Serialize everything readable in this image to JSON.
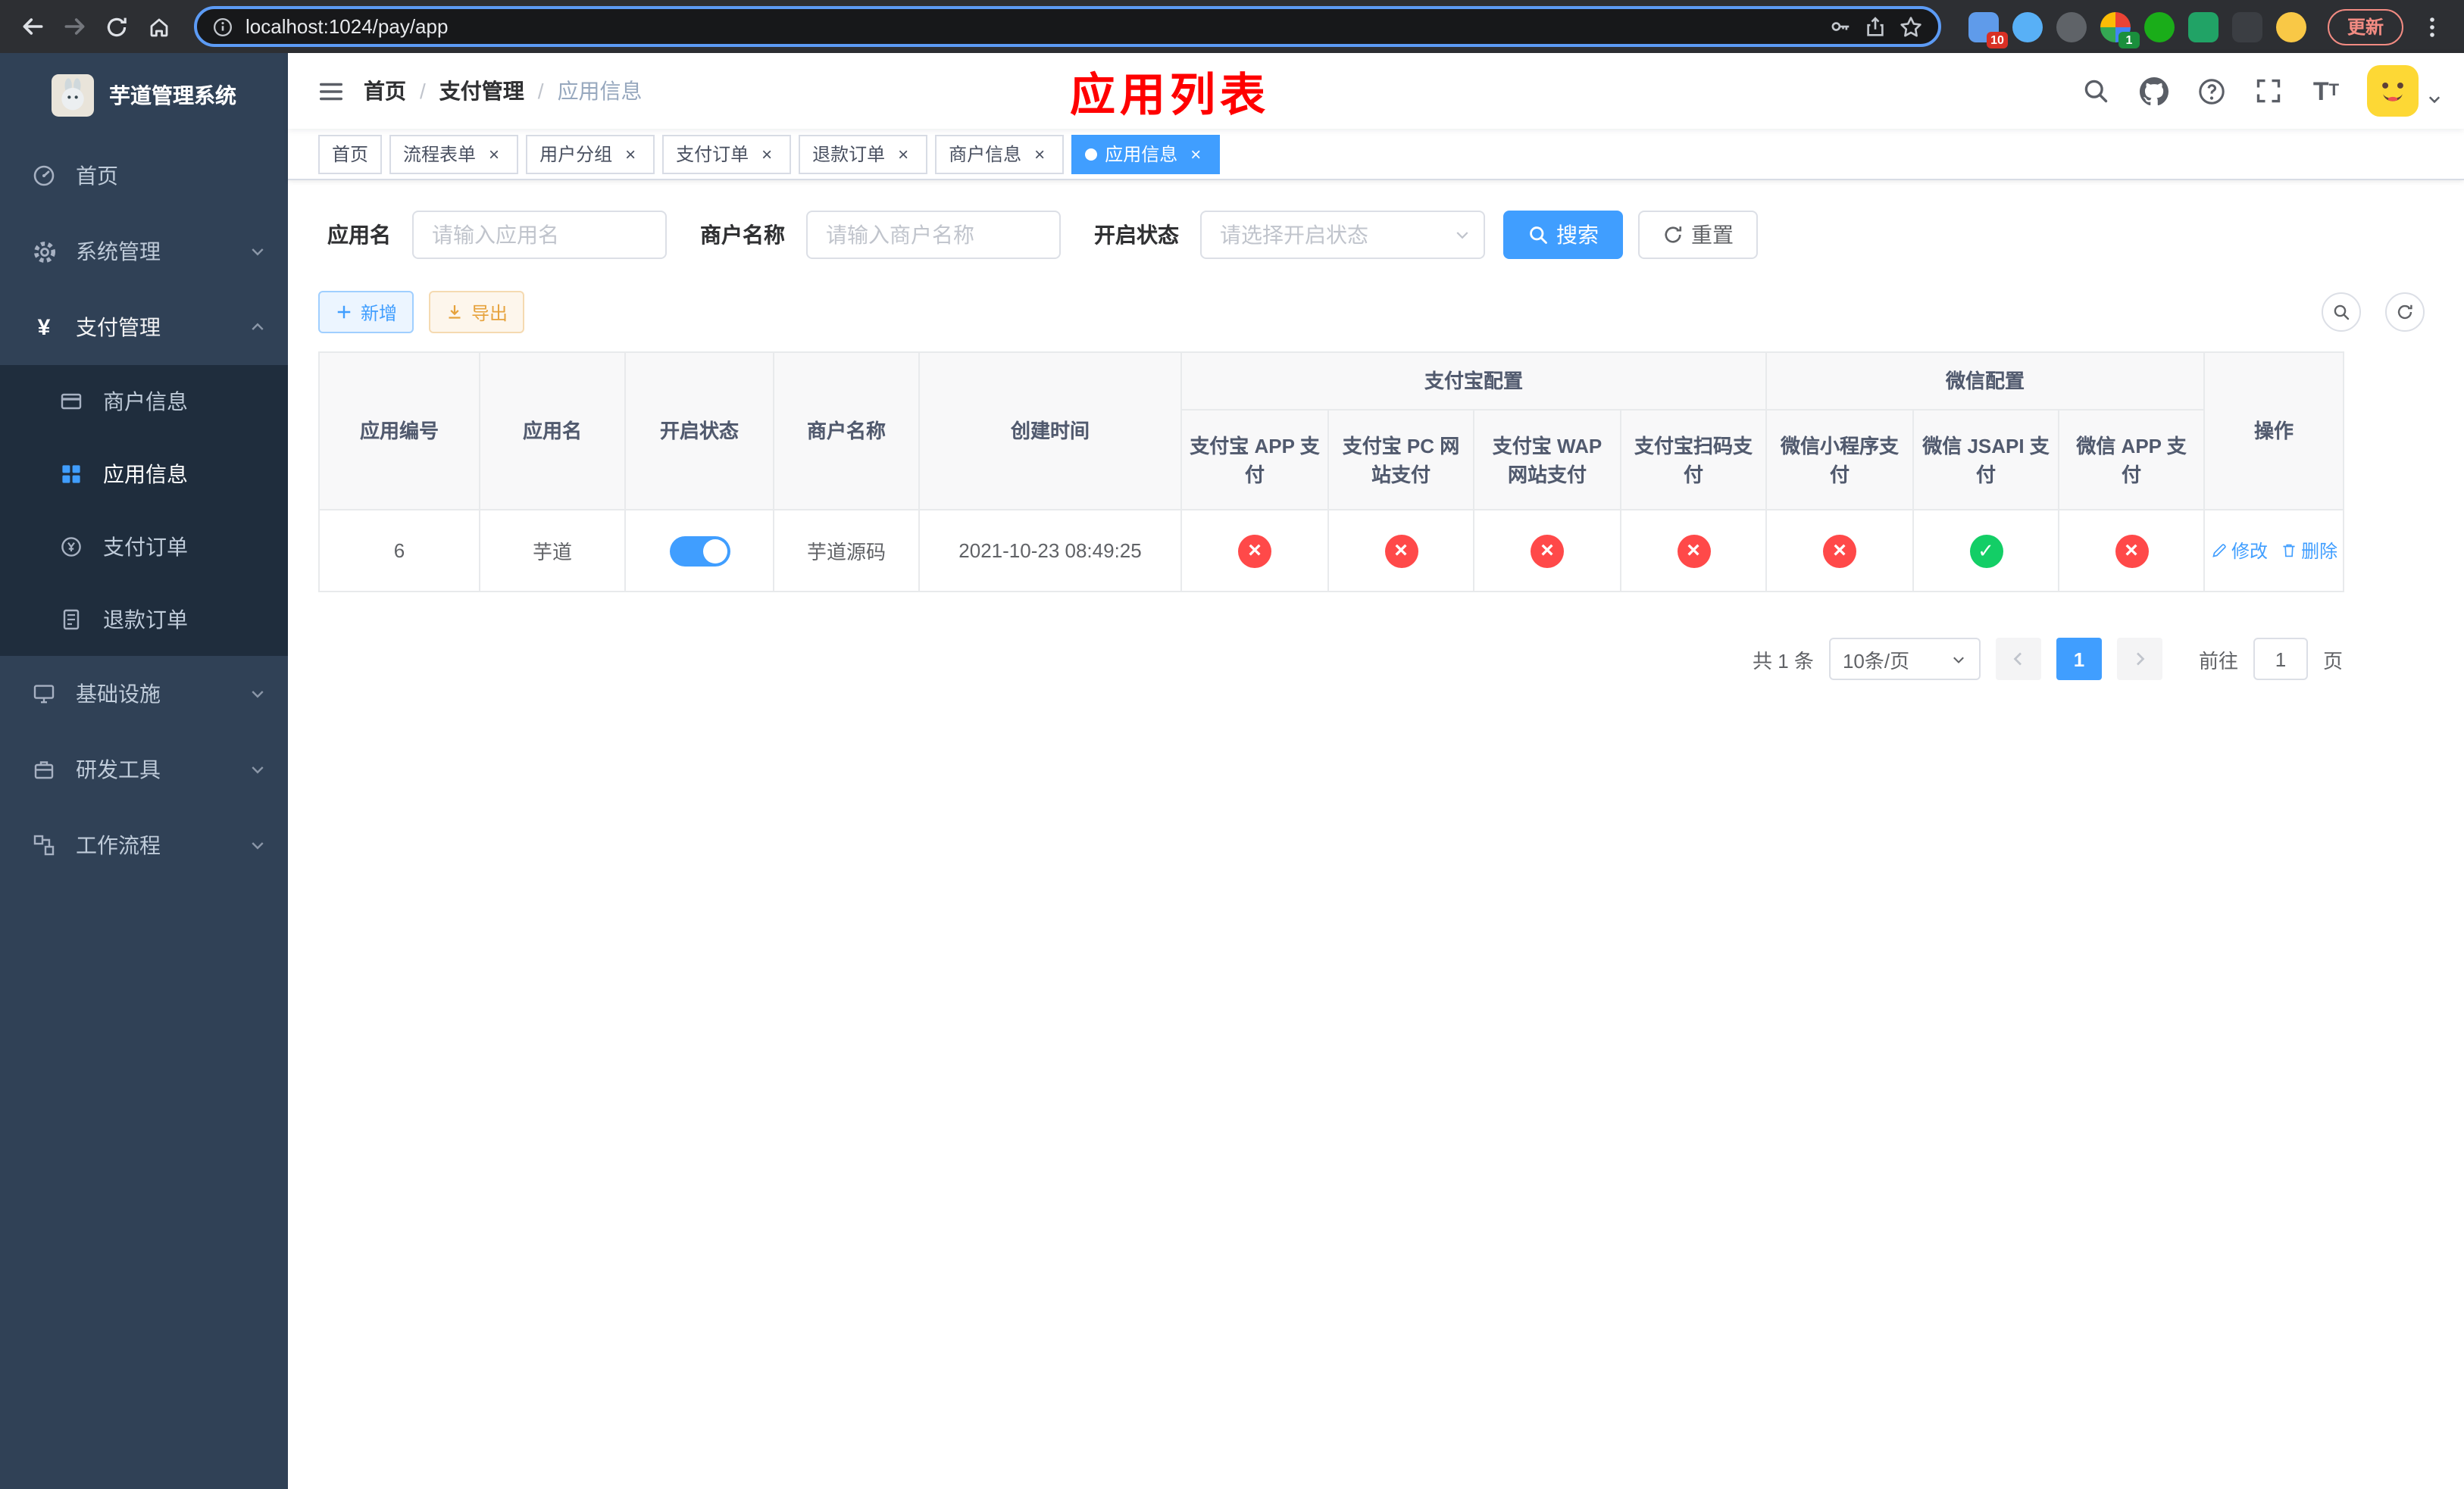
{
  "colors": {
    "accent": "#409eff",
    "ok": "#13ce66",
    "fail": "#ff4949",
    "title": "#ff0000",
    "warning": "#e6a23c"
  },
  "browser": {
    "url": "localhost:1024/pay/app",
    "update_label": "更新",
    "extensions_badge_1": "10",
    "extensions_badge_2": "1"
  },
  "sidebar": {
    "app_title": "芋道管理系统",
    "menu": [
      "首页",
      "系统管理",
      "支付管理",
      "基础设施",
      "研发工具",
      "工作流程"
    ],
    "submenu": [
      "商户信息",
      "应用信息",
      "支付订单",
      "退款订单"
    ]
  },
  "navbar": {
    "breadcrumb": [
      "首页",
      "支付管理",
      "应用信息"
    ],
    "page_title": "应用列表"
  },
  "tags": [
    "首页",
    "流程表单",
    "用户分组",
    "支付订单",
    "退款订单",
    "商户信息",
    "应用信息"
  ],
  "filters": {
    "app_name_label": "应用名",
    "app_name_placeholder": "请输入应用名",
    "merchant_label": "商户名称",
    "merchant_placeholder": "请输入商户名称",
    "status_label": "开启状态",
    "status_placeholder": "请选择开启状态",
    "search_label": "搜索",
    "reset_label": "重置"
  },
  "toolbar": {
    "add_label": "新增",
    "export_label": "导出"
  },
  "table": {
    "headers": {
      "id": "应用编号",
      "name": "应用名",
      "status": "开启状态",
      "merchant": "商户名称",
      "created": "创建时间",
      "alipay_group": "支付宝配置",
      "wechat_group": "微信配置",
      "alipay_app": "支付宝 APP 支付",
      "alipay_pc": "支付宝 PC 网站支付",
      "alipay_wap": "支付宝 WAP 网站支付",
      "alipay_scan": "支付宝扫码支付",
      "wx_mini": "微信小程序支付",
      "wx_jsapi": "微信 JSAPI 支付",
      "wx_app": "微信 APP 支付",
      "action": "操作"
    },
    "row": {
      "id": "6",
      "name": "芋道",
      "enabled": true,
      "merchant": "芋道源码",
      "created": "2021-10-23 08:49:25",
      "channels": [
        "fail",
        "fail",
        "fail",
        "fail",
        "fail",
        "ok",
        "fail"
      ],
      "edit_label": "修改",
      "delete_label": "删除"
    }
  },
  "pagination": {
    "total": "共 1 条",
    "page_size": "10条/页",
    "page": "1",
    "goto_label": "前往",
    "goto_value": "1",
    "page_unit": "页"
  }
}
